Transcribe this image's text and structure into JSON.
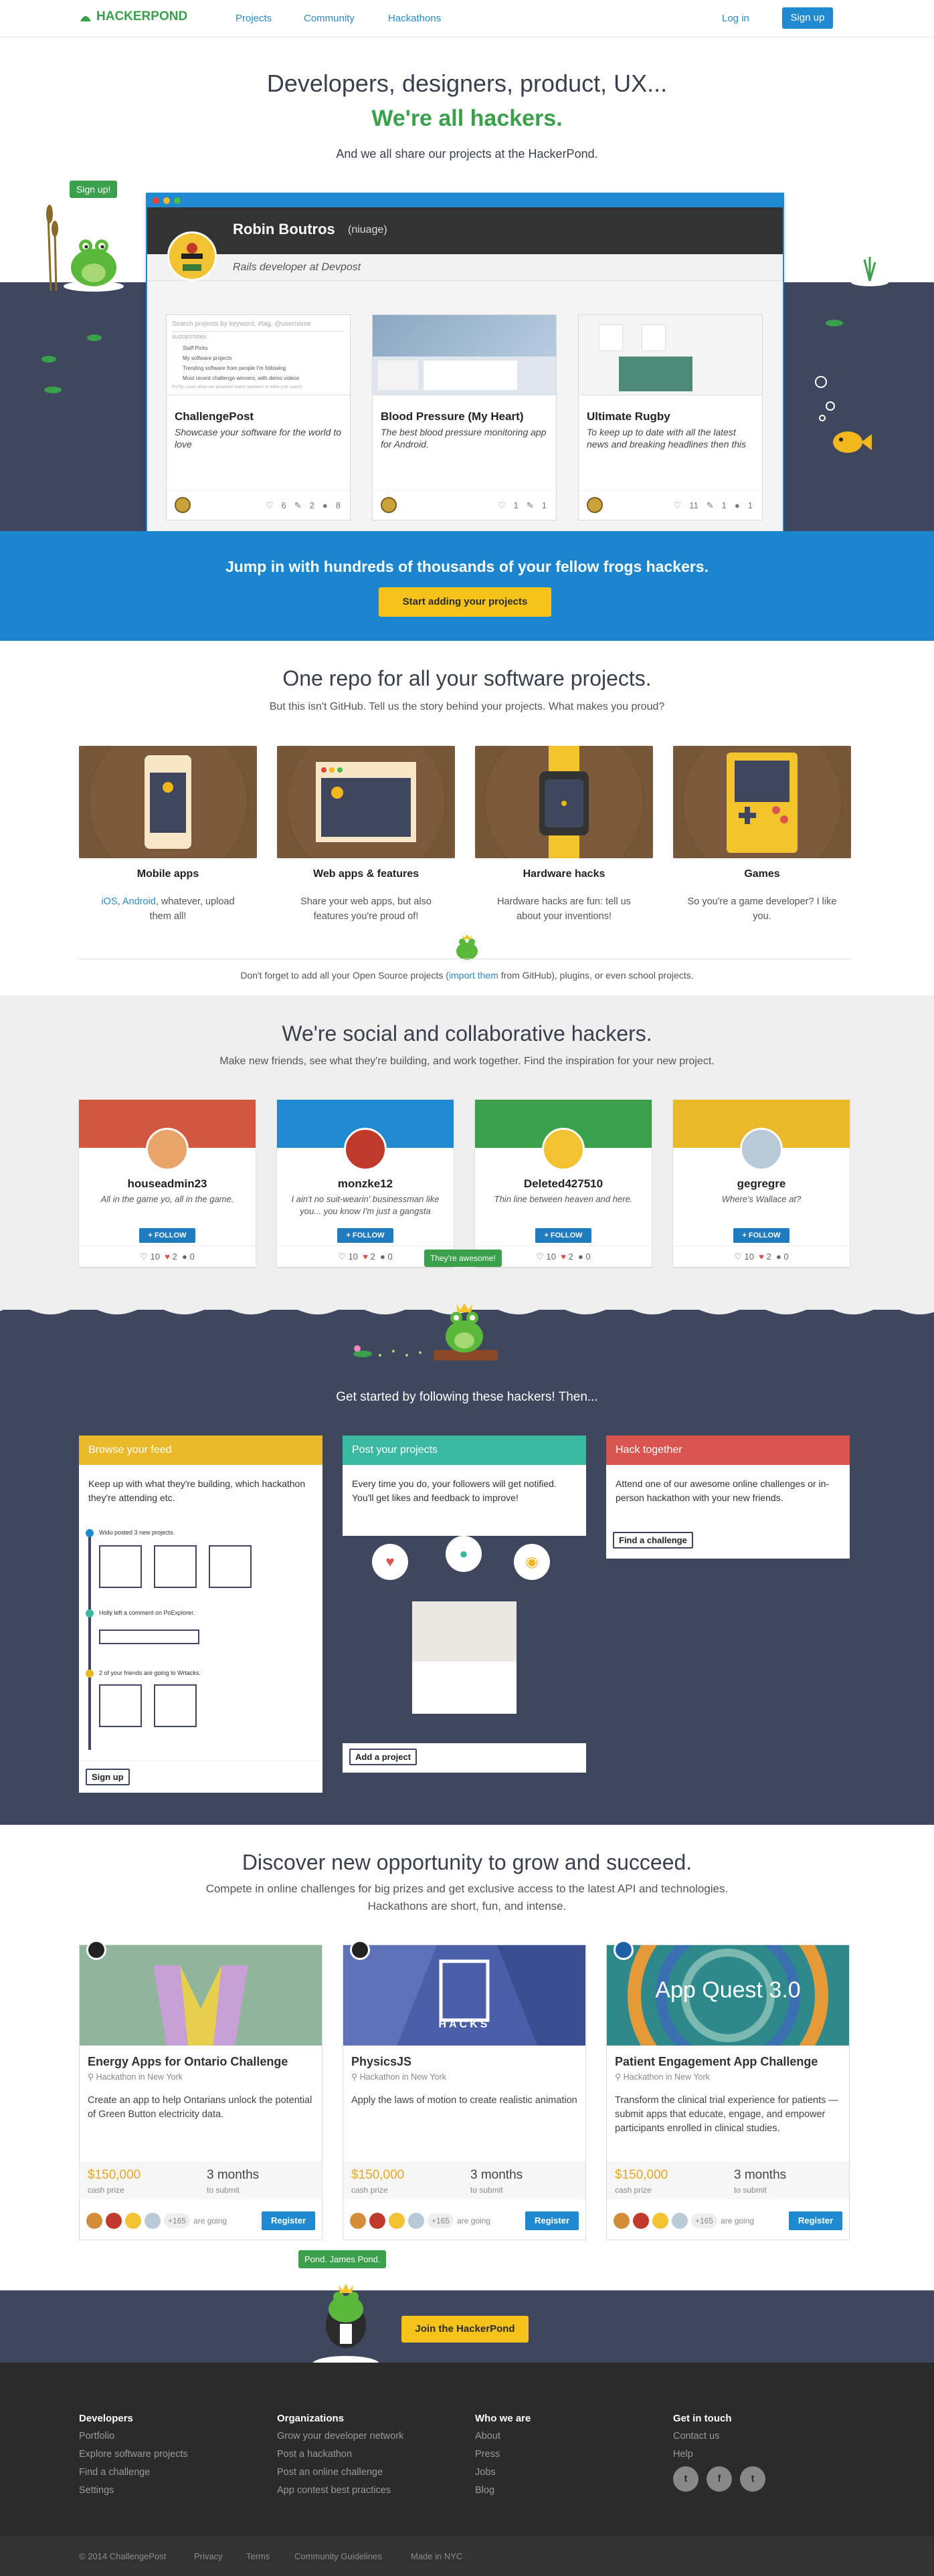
{
  "nav": {
    "logo": "HACKERPOND",
    "links": [
      "Projects",
      "Community",
      "Hackathons"
    ],
    "login": "Log in",
    "signup": "Sign up"
  },
  "hero": {
    "title": "Developers, designers, product, UX...",
    "subtitle": "We're all hackers.",
    "tagline": "And we all share our projects at the HackerPond.",
    "signup_bubble": "Sign up!",
    "profile_name": "Robin Boutros",
    "profile_handle": "(niuage)",
    "profile_bio": "Rails developer at Devpost",
    "search_placeholder": "Search projects by keyword, #tag, @username",
    "search_suggestions_header": "SUGGESTIONS",
    "search_suggestions": [
      "Staff Picks",
      "My software projects",
      "Trending software from people I'm following",
      "Most recent challenge winners, with demo videos"
    ],
    "search_prottip": "ProTip: Learn about our advanced search operators to refine your search.",
    "projects": [
      {
        "title": "ChallengePost",
        "desc": "Showcase your software for the world to love",
        "likes": "6",
        "comments": "2",
        "views": "8"
      },
      {
        "title": "Blood Pressure (My Heart)",
        "desc": "The best blood pressure monitoring app for Android.",
        "likes": "1",
        "comments": "1",
        "views": ""
      },
      {
        "title": "Ultimate Rugby",
        "desc": "To keep up to date with all the latest news and breaking headlines then this",
        "likes": "11",
        "comments": "1",
        "views": "1"
      }
    ]
  },
  "join_banner": {
    "text": "Jump in with hundreds of thousands of your fellow frogs hackers.",
    "button": "Start adding your projects"
  },
  "repo": {
    "title": "One repo for all your software projects.",
    "subtitle": "But this isn't GitHub. Tell us the story behind your projects. What makes you proud?",
    "tiles": [
      {
        "label": "Mobile apps",
        "desc_pre": "",
        "link1": "iOS",
        "link2": "Android",
        "desc": ", whatever, upload them all!"
      },
      {
        "label": "Web apps & features",
        "desc": "Share your web apps, but also features you're proud of!"
      },
      {
        "label": "Hardware hacks",
        "desc": "Hardware hacks are fun: tell us about your inventions!"
      },
      {
        "label": "Games",
        "desc": "So you're a game developer? I like you."
      }
    ],
    "note_pre": "Don't forget to add all your Open Source projects (",
    "note_link": "import them",
    "note_post": " from GitHub), plugins, or even school projects."
  },
  "social": {
    "title": "We're social and collaborative hackers.",
    "subtitle": "Make new friends, see what they're building, and work together. Find the inspiration for your new project.",
    "follow": "+ FOLLOW",
    "people": [
      {
        "name": "houseadmin23",
        "bio": "All in the game yo, all in the game.",
        "likes": "10",
        "hearts": "2",
        "comments": "0",
        "color": "#d2573f"
      },
      {
        "name": "monzke12",
        "bio": "I ain't no suit-wearin' businessman like you... you know I'm just a gangsta",
        "likes": "10",
        "hearts": "2",
        "comments": "0",
        "color": "#1f8ad0"
      },
      {
        "name": "Deleted427510",
        "bio": "Thin line between heaven and here.",
        "likes": "10",
        "hearts": "2",
        "comments": "0",
        "color": "#3aa04b"
      },
      {
        "name": "gegregre",
        "bio": "Where's Wallace at?",
        "likes": "10",
        "hearts": "2",
        "comments": "0",
        "color": "#e9b92a"
      }
    ],
    "awesome_bubble": "They're awesome!"
  },
  "started": {
    "title": "Get started by following these hackers! Then...",
    "cards": [
      {
        "header": "Browse your feed",
        "color": "#e9b92a",
        "body": "Keep up with what they're building, which hackathon they're attending etc.",
        "feed": [
          "Widu posted 3 new projects.",
          "Holly left a comment on PoExplorer.",
          "2 of your friends are going to Wrtacks."
        ],
        "button": "Sign up"
      },
      {
        "header": "Post your projects",
        "color": "#3bb8a0",
        "body": "Every time you do, your followers will get notified. You'll get likes and feedback to improve!",
        "button": "Add a project"
      },
      {
        "header": "Hack together",
        "color": "#d9534f",
        "body": "Attend one of our awesome online challenges or in-person hackathon with your new friends.",
        "button": "Find a challenge"
      }
    ]
  },
  "discover": {
    "title": "Discover new opportunity to grow and succeed.",
    "subtitle": "Compete in online challenges for big prizes and get exclusive access to the latest API and technologies.",
    "subtitle2": "Hackathons are short, fun, and intense.",
    "challenges": [
      {
        "title": "Energy Apps for Ontario Challenge",
        "location": "Hackathon in New York",
        "desc": "Create an app to help Ontarians unlock the potential of Green Button electricity data.",
        "prize": "$150,000",
        "prize_label": "cash prize",
        "time": "3 months",
        "time_label": "to submit",
        "going": "+165",
        "going_label": "are going",
        "button": "Register"
      },
      {
        "title": "PhysicsJS",
        "location": "Hackathon in New York",
        "desc": "Apply the laws of motion to create realistic animation",
        "prize": "$150,000",
        "prize_label": "cash prize",
        "time": "3 months",
        "time_label": "to submit",
        "going": "+165",
        "going_label": "are going",
        "button": "Register",
        "image_text": "HACKS"
      },
      {
        "title": "Patient Engagement App Challenge",
        "location": "Hackathon in New York",
        "desc": "Transform the clinical trial experience for patients — submit apps that educate, engage, and empower participants enrolled in clinical studies.",
        "prize": "$150,000",
        "prize_label": "cash prize",
        "time": "3 months",
        "time_label": "to submit",
        "going": "+165",
        "going_label": "are going",
        "button": "Register",
        "image_text": "App Quest 3.0"
      }
    ]
  },
  "cta": {
    "bubble": "Pond. James Pond.",
    "button": "Join the HackerPond"
  },
  "footer": {
    "cols": [
      {
        "title": "Developers",
        "links": [
          "Portfolio",
          "Explore software projects",
          "Find a challenge",
          "Settings"
        ]
      },
      {
        "title": "Organizations",
        "links": [
          "Grow your developer network",
          "Post a hackathon",
          "Post an online challenge",
          "App contest best practices"
        ]
      },
      {
        "title": "Who we are",
        "links": [
          "About",
          "Press",
          "Jobs",
          "Blog"
        ]
      },
      {
        "title": "Get in touch",
        "links": [
          "Contact us",
          "Help"
        ]
      }
    ],
    "bottom": [
      "© 2014 ChallengePost",
      "Privacy",
      "Terms",
      "Community Guidelines",
      "Made in NYC"
    ]
  }
}
